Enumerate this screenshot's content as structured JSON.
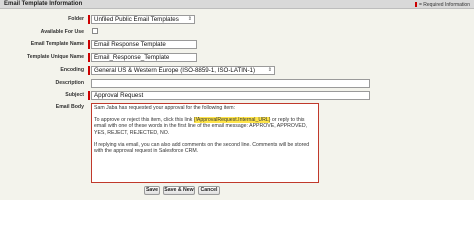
{
  "header": {
    "title": "Email Template Information",
    "required_info": "= Required Information"
  },
  "fields": {
    "folder": {
      "label": "Folder",
      "value": "Unfiled Public Email Templates"
    },
    "available": {
      "label": "Available For Use",
      "checked": false
    },
    "template_name": {
      "label": "Email Template Name",
      "value": "Email Response Template"
    },
    "unique_name": {
      "label": "Template Unique Name",
      "value": "Email_Response_Template"
    },
    "encoding": {
      "label": "Encoding",
      "value": "General US & Western Europe (ISO-8859-1, ISO-LATIN-1)"
    },
    "description": {
      "label": "Description",
      "value": ""
    },
    "subject": {
      "label": "Subject",
      "value": "Approval Request"
    },
    "email_body": {
      "label": "Email Body",
      "line1": "Sam Jaba  has requested your approval for the following item:",
      "para2_before": "To approve or reject this item, click this link ",
      "merge_field": "{!ApprovalRequest.Internal_URL}",
      "para2_after": " or reply to this email with one of these words in the first line of the email message: APPROVE, APPROVED, YES, REJECT, REJECTED, NO.",
      "para3": "If replying via email, you can also add comments on the second line. Comments will be stored with the approval request in Salesforce CRM."
    }
  },
  "buttons": {
    "save": "Save",
    "save_new": "Save & New",
    "cancel": "Cancel"
  },
  "colors": {
    "required": "#cc0000",
    "merge_highlight": "#ffe54a",
    "body_border": "#c0392b"
  }
}
